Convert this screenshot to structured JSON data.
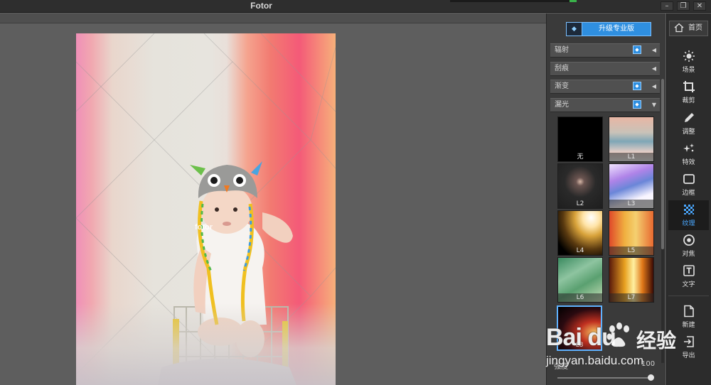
{
  "window": {
    "title": "Fotor",
    "minimize": "–",
    "restore": "❐",
    "close": "✕"
  },
  "topbar_progress": 0.06,
  "canvas": {
    "watermark": "fotor"
  },
  "panel": {
    "pro_button": "升级专业版",
    "sections": [
      {
        "label": "辐射",
        "premium": true
      },
      {
        "label": "刮痕",
        "premium": false
      },
      {
        "label": "渐变",
        "premium": true
      },
      {
        "label": "漏光",
        "premium": true,
        "expanded": true
      }
    ],
    "thumbnails": [
      {
        "label": "无"
      },
      {
        "label": "L1"
      },
      {
        "label": "L2"
      },
      {
        "label": "L3"
      },
      {
        "label": "L4"
      },
      {
        "label": "L5"
      },
      {
        "label": "L6"
      },
      {
        "label": "L7"
      },
      {
        "label": "L8",
        "selected": true
      }
    ],
    "slider": {
      "label": "强度",
      "value": "100",
      "level": 1.0
    }
  },
  "nav": {
    "home": "首页",
    "items": [
      {
        "label": "场景",
        "icon": "sun-icon"
      },
      {
        "label": "裁剪",
        "icon": "crop-icon"
      },
      {
        "label": "调整",
        "icon": "pencil-icon"
      },
      {
        "label": "特效",
        "icon": "sparkle-icon"
      },
      {
        "label": "边框",
        "icon": "frame-icon"
      },
      {
        "label": "纹理",
        "icon": "texture-icon",
        "active": true
      },
      {
        "label": "对焦",
        "icon": "focus-icon"
      },
      {
        "label": "文字",
        "icon": "text-icon"
      },
      {
        "label": "新建",
        "icon": "new-file-icon"
      },
      {
        "label": "导出",
        "icon": "export-icon"
      }
    ]
  },
  "baidu_watermark": {
    "brand": "Bai du",
    "product": "经验",
    "url": "jingyan.baidu.com"
  },
  "colors": {
    "accent": "#2f8fe0",
    "active_nav": "#4aa8ff",
    "panel_bg": "#3a3a3a",
    "canvas_bg": "#5e5e5e"
  }
}
